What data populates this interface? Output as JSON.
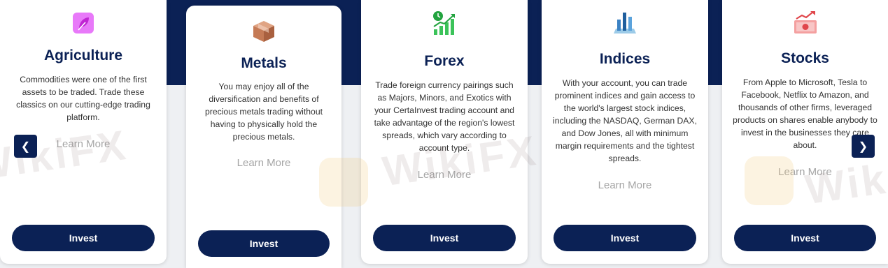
{
  "cards": [
    {
      "icon": "plant-leaf-icon",
      "title": "Agriculture",
      "lines": [
        "Commodities were one of the first",
        "assets to be traded. Trade these",
        "classics on our cutting-edge trading",
        "platform."
      ],
      "learn_more": "Learn More",
      "invest": "Invest"
    },
    {
      "icon": "metal-cube-icon",
      "title": "Metals",
      "lines": [
        "You may enjoy all of the",
        "diversification and benefits of",
        "precious metals trading without",
        "having to physically hold the",
        "precious metals."
      ],
      "learn_more": "Learn More",
      "invest": "Invest"
    },
    {
      "icon": "forex-growth-chart-icon",
      "title": "Forex",
      "lines": [
        "Trade foreign currency pairings such",
        "as Majors, Minors, and Exotics with",
        "your CertaInvest trading account and",
        "take advantage of the region's lowest",
        "spreads, which vary according to",
        "account type."
      ],
      "learn_more": "Learn More",
      "invest": "Invest"
    },
    {
      "icon": "indices-bars-icon",
      "title": "Indices",
      "lines": [
        "With your account, you can trade",
        "prominent indices and gain access to",
        "the world's largest stock indices,",
        "including the NASDAQ, German DAX,",
        "and Dow Jones, all with minimum",
        "margin requirements and the tightest",
        "spreads."
      ],
      "learn_more": "Learn More",
      "invest": "Invest"
    },
    {
      "icon": "stocks-cash-icon",
      "title": "Stocks",
      "lines": [
        "From Apple to Microsoft, Tesla to",
        "Facebook, Netflix to Amazon, and",
        "thousands of other firms, leveraged",
        "products on shares enable anybody to",
        "invest in the businesses they care",
        "about."
      ],
      "learn_more": "Learn More",
      "invest": "Invest"
    }
  ],
  "nav": {
    "prev": "❮",
    "next": "❯"
  },
  "watermark": "WikiFX",
  "colors": {
    "navy": "#0b2155",
    "muted": "#a5a5a5",
    "background": "#eef0f3"
  }
}
